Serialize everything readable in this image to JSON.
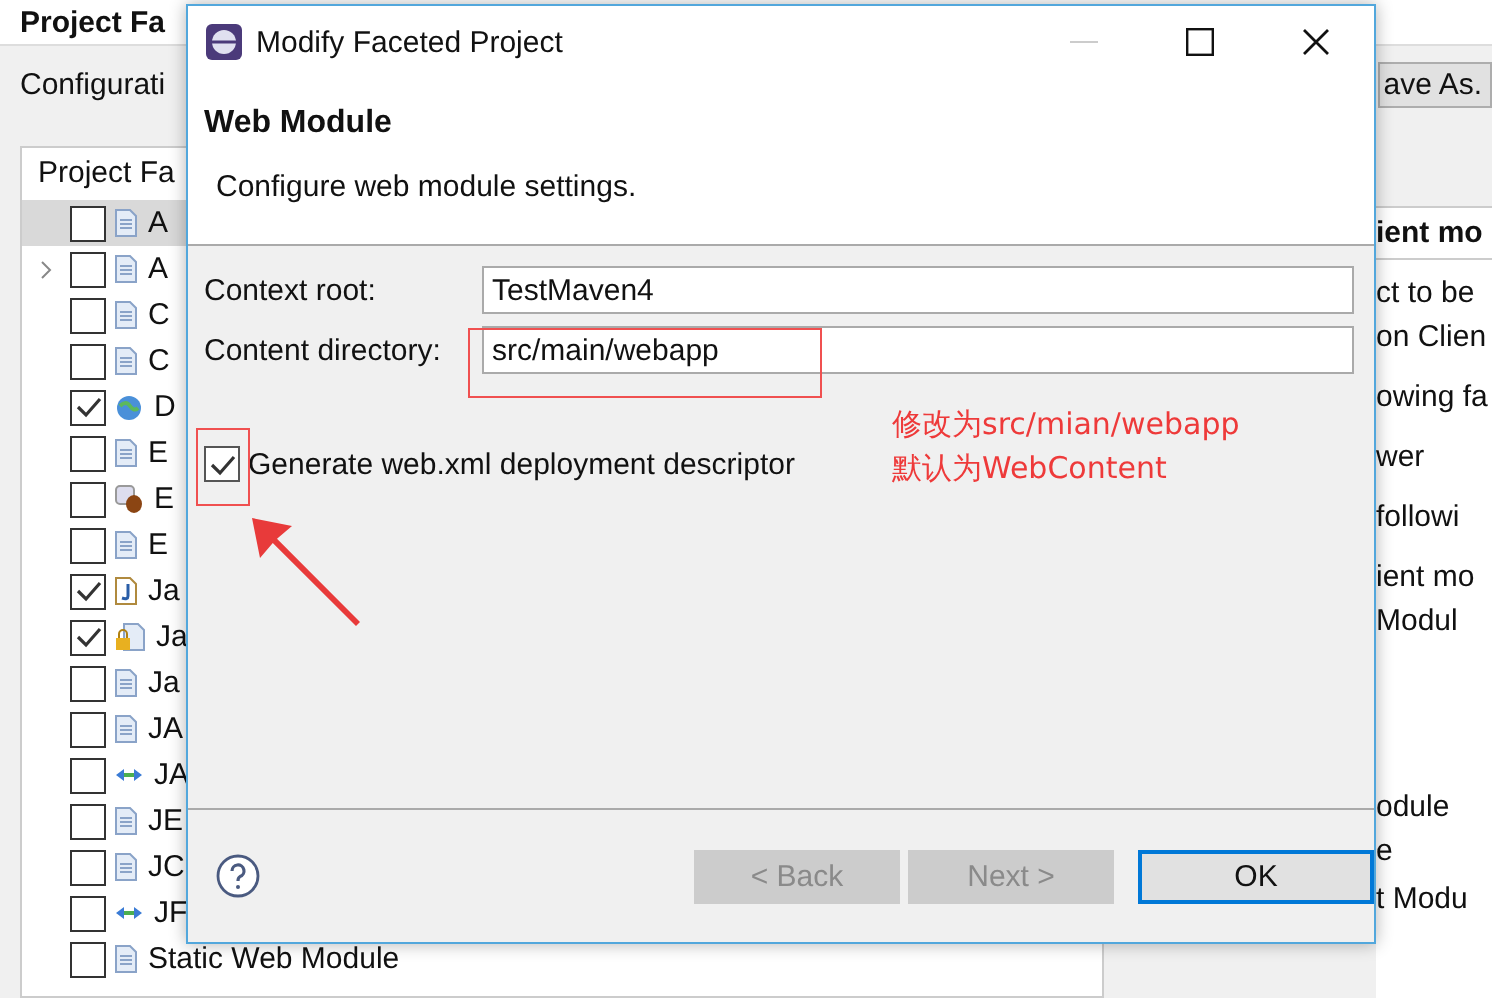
{
  "background": {
    "title": "Project Fa",
    "configuration_label": "Configurati",
    "save_button": "ave As.",
    "facets_header": "Project Fa",
    "facets": [
      {
        "label": "A",
        "kind": "doc",
        "checked": false,
        "selected": true,
        "expandable": false
      },
      {
        "label": "A",
        "kind": "doc",
        "checked": false,
        "selected": false,
        "expandable": true
      },
      {
        "label": "C",
        "kind": "doc",
        "checked": false,
        "selected": false,
        "expandable": false
      },
      {
        "label": "C",
        "kind": "doc",
        "checked": false,
        "selected": false,
        "expandable": false
      },
      {
        "label": "D",
        "kind": "globe",
        "checked": true,
        "selected": false,
        "expandable": false
      },
      {
        "label": "E",
        "kind": "doc",
        "checked": false,
        "selected": false,
        "expandable": false
      },
      {
        "label": "E",
        "kind": "bean",
        "checked": false,
        "selected": false,
        "expandable": false
      },
      {
        "label": "E",
        "kind": "doc",
        "checked": false,
        "selected": false,
        "expandable": false
      },
      {
        "label": "Ja",
        "kind": "java",
        "checked": true,
        "selected": false,
        "expandable": false
      },
      {
        "label": "Ja",
        "kind": "lock",
        "checked": true,
        "selected": false,
        "expandable": false
      },
      {
        "label": "Ja",
        "kind": "doc",
        "checked": false,
        "selected": false,
        "expandable": false
      },
      {
        "label": "JA",
        "kind": "doc",
        "checked": false,
        "selected": false,
        "expandable": false
      },
      {
        "label": "JA",
        "kind": "arrows",
        "checked": false,
        "selected": false,
        "expandable": false
      },
      {
        "label": "JE",
        "kind": "doc",
        "checked": false,
        "selected": false,
        "expandable": false
      },
      {
        "label": "JC",
        "kind": "doc",
        "checked": false,
        "selected": false,
        "expandable": false
      },
      {
        "label": "JF",
        "kind": "arrows",
        "checked": false,
        "selected": false,
        "expandable": false
      },
      {
        "label": "Static Web Module",
        "kind": "doc",
        "checked": false,
        "selected": false,
        "expandable": false
      }
    ],
    "details_header": "ient mo",
    "details_lines": [
      "ct to be",
      "on Clien",
      "owing fa",
      "wer",
      "followi",
      "ient mo",
      "Modul",
      "odule",
      "e",
      "t Modu"
    ]
  },
  "dialog": {
    "title": "Modify Faceted Project",
    "title_buttons": [
      {
        "kind": "minimize",
        "disabled": true
      },
      {
        "kind": "maximize",
        "disabled": false
      },
      {
        "kind": "close",
        "disabled": false
      }
    ],
    "heading": "Web Module",
    "description": "Configure web module settings.",
    "fields": [
      {
        "label": "Context root:",
        "value": "TestMaven4"
      },
      {
        "label": "Content directory:",
        "value": "src/main/webapp"
      }
    ],
    "checkbox": {
      "label": "Generate web.xml deployment descriptor",
      "checked": true
    },
    "buttons": [
      {
        "label": "< Back",
        "disabled": true,
        "default": false
      },
      {
        "label": "Next >",
        "disabled": true,
        "default": false
      },
      {
        "label": "OK",
        "disabled": false,
        "default": true
      }
    ]
  },
  "annotations": [
    "修改为src/mian/webapp",
    "默认为WebContent"
  ]
}
